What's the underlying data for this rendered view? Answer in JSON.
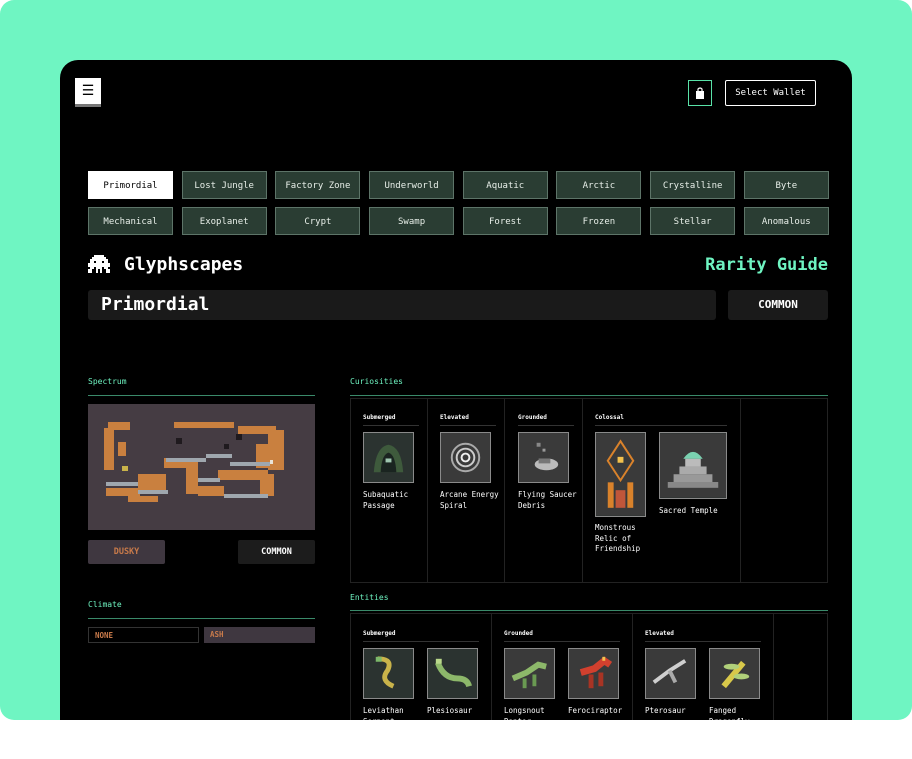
{
  "header": {
    "menu_icon": "hamburger-icon",
    "bag_icon": "shopping-bag-icon",
    "wallet_label": "Select Wallet"
  },
  "biomes": {
    "active": "Primordial",
    "tabs": [
      "Primordial",
      "Lost Jungle",
      "Factory Zone",
      "Underworld",
      "Aquatic",
      "Arctic",
      "Crystalline",
      "Byte",
      "Mechanical",
      "Exoplanet",
      "Crypt",
      "Swamp",
      "Forest",
      "Frozen",
      "Stellar",
      "Anomalous"
    ]
  },
  "brand": {
    "name": "Glyphscapes",
    "icon": "space-invader-icon"
  },
  "rarity_guide_label": "Rarity Guide",
  "selected": {
    "name": "Primordial",
    "rarity": "COMMON"
  },
  "spectrum": {
    "label": "Spectrum",
    "value": "DUSKY",
    "value_color": "#c87a4a",
    "rarity": "COMMON"
  },
  "climate": {
    "label": "Climate",
    "values": [
      "NONE",
      "ASH"
    ]
  },
  "curiosities": {
    "label": "Curiosities",
    "groups": [
      {
        "name": "Submerged",
        "items": [
          "Subaquatic Passage"
        ]
      },
      {
        "name": "Elevated",
        "items": [
          "Arcane Energy Spiral"
        ]
      },
      {
        "name": "Grounded",
        "items": [
          "Flying Saucer Debris"
        ]
      },
      {
        "name": "Colossal",
        "items": [
          "Monstrous Relic of Friendship",
          "Sacred Temple"
        ]
      }
    ]
  },
  "entities": {
    "label": "Entities",
    "groups": [
      {
        "name": "Submerged",
        "items": [
          "Leviathan Serpent",
          "Plesiosaur"
        ]
      },
      {
        "name": "Grounded",
        "items": [
          "Longsnout Raptor",
          "Ferociraptor"
        ]
      },
      {
        "name": "Elevated",
        "items": [
          "Pterosaur",
          "Fanged Dragonfly"
        ]
      }
    ]
  }
}
